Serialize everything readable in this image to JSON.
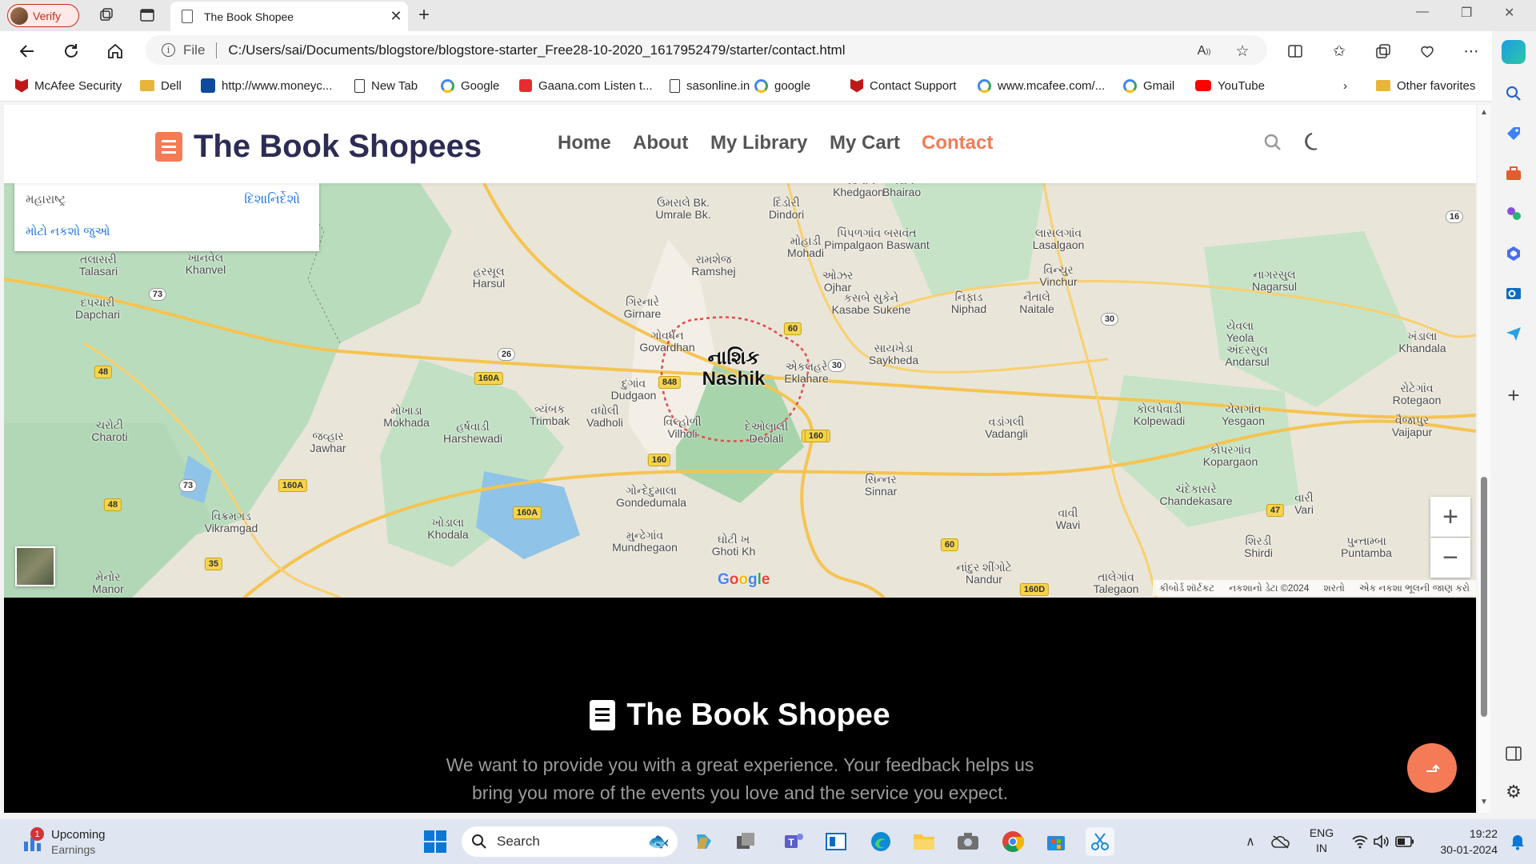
{
  "browser": {
    "profile_label": "Verify",
    "tab_title": "The Book Shopee",
    "file_label": "File",
    "url": "C:/Users/sai/Documents/blogstore/blogstore-starter_Free28-10-2020_1617952479/starter/contact.html"
  },
  "favorites": [
    {
      "label": "McAfee Security",
      "icon": "mcafee-icon",
      "color": "#c01818"
    },
    {
      "label": "Dell",
      "icon": "folder-icon",
      "color": "#e8b53a"
    },
    {
      "label": "http://www.moneyc...",
      "icon": "moneycontrol-icon",
      "color": "#0b4a9c"
    },
    {
      "label": "New Tab",
      "icon": "page-icon",
      "color": "#333333"
    },
    {
      "label": "Google",
      "icon": "google-icon",
      "color": "#4285f4"
    },
    {
      "label": "Gaana.com Listen t...",
      "icon": "gaana-icon",
      "color": "#e72c30"
    },
    {
      "label": "sasonline.in",
      "icon": "page-icon",
      "color": "#333333"
    },
    {
      "label": "google",
      "icon": "google-icon",
      "color": "#4285f4"
    },
    {
      "label": "Contact Support",
      "icon": "mcafee-icon",
      "color": "#c01818"
    },
    {
      "label": "www.mcafee.com/...",
      "icon": "google-icon",
      "color": "#4285f4"
    },
    {
      "label": "Gmail",
      "icon": "google-icon",
      "color": "#4285f4"
    },
    {
      "label": "YouTube",
      "icon": "youtube-icon",
      "color": "#ff0000"
    }
  ],
  "other_favorites": "Other favorites",
  "site": {
    "logo_text": "The Book Shopees",
    "nav": [
      "Home",
      "About",
      "My Library",
      "My Cart",
      "Contact"
    ],
    "active_nav": "Contact",
    "accent_color": "#f47b56",
    "title_color": "#2c2c54"
  },
  "map": {
    "card_region": "મહારાષ્ટ્ર",
    "card_directions": "દિશાનિર્દેશો",
    "card_larger_map": "મોટો નકશો જુઓ",
    "google_logo": "Google",
    "attribution": [
      "કીબોર્ડ શૉર્ટકટ",
      "નકશાનો ડેટા ©2024",
      "શરતો",
      "એક નકશા ભૂલની જાણ કરો"
    ],
    "places": [
      {
        "g": "તલાસરી",
        "e": "Talasari"
      },
      {
        "g": "ખાનવેલ",
        "e": "Khanvel"
      },
      {
        "g": "દપચારી",
        "e": "Dapchari"
      },
      {
        "g": "હરસૂલ",
        "e": "Harsul"
      },
      {
        "g": "ઉમરાલે Bk.",
        "e": "Umrale Bk."
      },
      {
        "g": "દિંડોરી",
        "e": "Dindori"
      },
      {
        "g": "ખેડગાંવ",
        "e": "Khedgaon"
      },
      {
        "g": "ભૈરાવ",
        "e": "Bhairao"
      },
      {
        "g": "પિંપળગાંવ બસવંત",
        "e": "Pimpalgaon Baswant"
      },
      {
        "g": "મોહાડી",
        "e": "Mohadi"
      },
      {
        "g": "રામશેજ",
        "e": "Ramshej"
      },
      {
        "g": "ઓઝર",
        "e": "Ojhar"
      },
      {
        "g": "કસબે સુકેને",
        "e": "Kasabe Sukene"
      },
      {
        "g": "નિફાડ",
        "e": "Niphad"
      },
      {
        "g": "નૈતાલે",
        "e": "Naitale"
      },
      {
        "g": "લાસલગાંવ",
        "e": "Lasalgaon"
      },
      {
        "g": "વિન્ચુર",
        "e": "Vinchur"
      },
      {
        "g": "નાગરસુલ",
        "e": "Nagarsul"
      },
      {
        "g": "ગિરનારે",
        "e": "Girnare"
      },
      {
        "g": "ગોવર્ધન",
        "e": "Govardhan"
      },
      {
        "g": "નાશિક",
        "e": "Nashik",
        "big": true
      },
      {
        "g": "એકલહરે",
        "e": "Eklahare"
      },
      {
        "g": "સાયખેડા",
        "e": "Saykheda"
      },
      {
        "g": "યેવલા",
        "e": "Yeola"
      },
      {
        "g": "અંદરસુલ",
        "e": "Andarsul"
      },
      {
        "g": "ખંડાલા",
        "e": "Khandala"
      },
      {
        "g": "દુગાંવ",
        "e": "Dudgaon"
      },
      {
        "g": "ત્ર્યંબક",
        "e": "Trimbak"
      },
      {
        "g": "વધોલી",
        "e": "Vadholi"
      },
      {
        "g": "વિલ્હોળી",
        "e": "Vilholi"
      },
      {
        "g": "દેઓલાલી",
        "e": "Deolali"
      },
      {
        "g": "મોખાડા",
        "e": "Mokhada"
      },
      {
        "g": "હર્ષવાડી",
        "e": "Harshewadi"
      },
      {
        "g": "જવ્હાર",
        "e": "Jawhar"
      },
      {
        "g": "ચરોટી",
        "e": "Charoti"
      },
      {
        "g": "વડાંગલી",
        "e": "Vadangli"
      },
      {
        "g": "કોલપેવાડી",
        "e": "Kolpewadi"
      },
      {
        "g": "યેસગાંવ",
        "e": "Yesgaon"
      },
      {
        "g": "રોટેગાંવ",
        "e": "Rotegaon"
      },
      {
        "g": "વૈજાપુર",
        "e": "Vaijapur"
      },
      {
        "g": "કોપરગાંવ",
        "e": "Kopargaon"
      },
      {
        "g": "સિન્નર",
        "e": "Sinnar"
      },
      {
        "g": "ગોન્દેદુમાલા",
        "e": "Gondedumala"
      },
      {
        "g": "ચંદેકાસરે",
        "e": "Chandekasare"
      },
      {
        "g": "વારી",
        "e": "Vari"
      },
      {
        "g": "વાવી",
        "e": "Wavi"
      },
      {
        "g": "ખોડાલા",
        "e": "Khodala"
      },
      {
        "g": "વિક્રમગડ",
        "e": "Vikramgad"
      },
      {
        "g": "મુન્ઢેગાંવ",
        "e": "Mundhegaon"
      },
      {
        "g": "ઘોટી ખ",
        "e": "Ghoti Kh"
      },
      {
        "g": "શિરડી",
        "e": "Shirdi"
      },
      {
        "g": "પુન્તામ્બા",
        "e": "Puntamba"
      },
      {
        "g": "મેનોર",
        "e": "Manor"
      },
      {
        "g": "નાંદુર શીંગોટે",
        "e": "Nandur"
      },
      {
        "g": "તાલેગાંવ",
        "e": "Talegaon"
      }
    ],
    "shields": [
      "16",
      "73",
      "48",
      "26",
      "160A",
      "60",
      "30",
      "848",
      "160",
      "73",
      "160A",
      "48",
      "160A",
      "160A",
      "160",
      "47",
      "35",
      "60",
      "160D",
      "30"
    ]
  },
  "footer": {
    "title": "The Book Shopee",
    "text_line1": "We want to provide you with a great experience. Your feedback helps us",
    "text_line2": "bring you more of the events you love and the service you expect."
  },
  "taskbar": {
    "widget_badge": "1",
    "widget_title": "Upcoming",
    "widget_sub": "Earnings",
    "search": "Search",
    "lang1": "ENG",
    "lang2": "IN",
    "time": "19:22",
    "date": "30-01-2024"
  }
}
